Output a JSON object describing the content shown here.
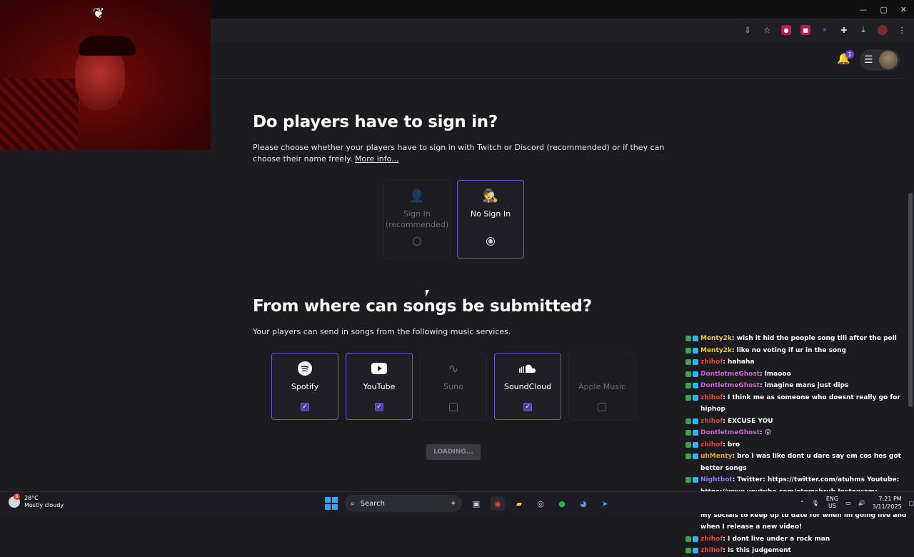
{
  "window_controls": {
    "minimize": "—",
    "maximize": "▢",
    "close": "✕"
  },
  "header": {
    "notification_count": "1"
  },
  "section_signin": {
    "title": "Do players have to sign in?",
    "description": "Please choose whether your players have to sign in with Twitch or Discord (recommended) or if they can choose their name freely.",
    "more_info": "More info...",
    "options": [
      {
        "label": "Sign In (recommended)",
        "selected": false,
        "disabled": true
      },
      {
        "label": "No Sign In",
        "selected": true,
        "disabled": false
      }
    ]
  },
  "section_songs": {
    "title": "From where can songs be submitted?",
    "description": "Your players can send in songs from the following music services.",
    "services": [
      {
        "label": "Spotify",
        "checked": true,
        "disabled": false,
        "icon": "spotify-icon"
      },
      {
        "label": "YouTube",
        "checked": true,
        "disabled": false,
        "icon": "youtube-icon"
      },
      {
        "label": "Suno",
        "checked": false,
        "disabled": true,
        "icon": "suno-icon"
      },
      {
        "label": "SoundCloud",
        "checked": true,
        "disabled": false,
        "icon": "soundcloud-icon"
      },
      {
        "label": "Apple Music",
        "checked": false,
        "disabled": true,
        "icon": "apple-icon"
      }
    ],
    "loading_label": "LOADING..."
  },
  "chat": [
    {
      "user": "Menty2k",
      "color": "#e8c547",
      "text": ": wish it hid the people song till after the poll"
    },
    {
      "user": "Menty2k",
      "color": "#e8c547",
      "text": ": like no voting if ur in the song"
    },
    {
      "user": "zhihof",
      "color": "#e0453a",
      "text": ": hahaha"
    },
    {
      "user": "DontletmeGhost",
      "color": "#d25fd6",
      "text": ": lmaooo"
    },
    {
      "user": "DontletmeGhost",
      "color": "#d25fd6",
      "text": ": imagine mans just dips"
    },
    {
      "user": "zhihof",
      "color": "#e0453a",
      "text": ": I think me as someone who doesnt really go for hiphop"
    },
    {
      "user": "zhihof",
      "color": "#e0453a",
      "text": ": EXCUSE YOU"
    },
    {
      "user": "DontletmeGhost",
      "color": "#d25fd6",
      "text": ": 😮"
    },
    {
      "user": "zhihof",
      "color": "#e0453a",
      "text": ": bro"
    },
    {
      "user": "uhMenty",
      "color": "#e8a33a",
      "text": ": bro I was like dont u dare say em cos hes got better songs"
    },
    {
      "user": "Nightbot",
      "color": "#8a7ef0",
      "text": ": Twitter: https://twitter.com/atuhms Youtube: https://www.youtube.com/atomsbruh Instagram: @KickAtuhms TikTok: @atuhms Be sure to check my out my socials to keep up to date for when im going live and when I release a new video!"
    },
    {
      "user": "zhihof",
      "color": "#e0453a",
      "text": ": I dont live under a rock man"
    },
    {
      "user": "zhihof",
      "color": "#e0453a",
      "text": ": Is this judgement"
    }
  ],
  "taskbar": {
    "temperature": "28°C",
    "weather": "Mostly cloudy",
    "weather_badge": "8",
    "search_label": "Search",
    "lang": "ENG",
    "region": "US",
    "time": "7:21 PM",
    "date": "3/11/2025"
  }
}
